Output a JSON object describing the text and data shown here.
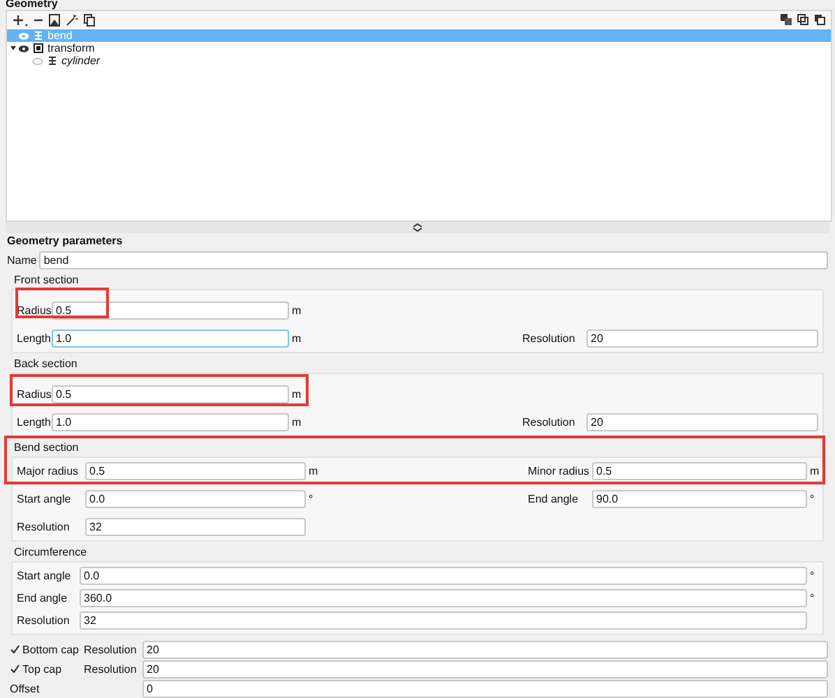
{
  "panel_title": "Geometry",
  "tree": [
    {
      "label": "bend",
      "kind": "shape",
      "visible": true,
      "selected": true
    },
    {
      "label": "transform",
      "kind": "group",
      "visible": true,
      "selected": false,
      "expanded": true,
      "children": [
        {
          "label": "cylinder",
          "kind": "shape",
          "visible": false,
          "selected": false
        }
      ]
    }
  ],
  "parameters_title": "Geometry parameters",
  "name": {
    "label": "Name",
    "value": "bend"
  },
  "sections": [
    {
      "title": "Front section",
      "kind": "pair",
      "rows": [
        [
          {
            "label": "Radius",
            "value": "0.5",
            "unit": "m",
            "highlighted": true
          }
        ],
        [
          {
            "label": "Length",
            "value": "1.0",
            "unit": "m",
            "focused": true
          },
          {
            "label": "Resolution",
            "value": "20"
          }
        ]
      ]
    },
    {
      "title": "Back section",
      "kind": "pair",
      "rows": [
        [
          {
            "label": "Radius",
            "value": "0.5",
            "unit": "m",
            "highlighted": true
          }
        ],
        [
          {
            "label": "Length",
            "value": "1.0",
            "unit": "m"
          },
          {
            "label": "Resolution",
            "value": "20"
          }
        ]
      ]
    },
    {
      "title": "Bend section",
      "kind": "pair",
      "highlighted": true,
      "rows": [
        [
          {
            "label": "Major radius",
            "value": "0.5",
            "unit": "m"
          },
          {
            "label": "Minor radius",
            "value": "0.5",
            "unit": "m"
          }
        ],
        [
          {
            "label": "Start angle",
            "value": "0.0",
            "unit": "°"
          },
          {
            "label": "End angle",
            "value": "90.0",
            "unit": "°"
          }
        ],
        [
          {
            "label": "Resolution",
            "value": "32"
          }
        ]
      ]
    },
    {
      "title": "Circumference",
      "kind": "stack",
      "rows": [
        [
          {
            "label": "Start angle",
            "value": "0.0",
            "unit": "°"
          }
        ],
        [
          {
            "label": "End angle",
            "value": "360.0",
            "unit": "°"
          }
        ],
        [
          {
            "label": "Resolution",
            "value": "32"
          }
        ]
      ]
    }
  ],
  "caps": [
    {
      "label": "Bottom cap",
      "checked": true,
      "field": {
        "label": "Resolution",
        "value": "20"
      }
    },
    {
      "label": "Top cap",
      "checked": true,
      "field": {
        "label": "Resolution",
        "value": "20"
      }
    }
  ],
  "offset": {
    "label": "Offset",
    "value": "0"
  }
}
